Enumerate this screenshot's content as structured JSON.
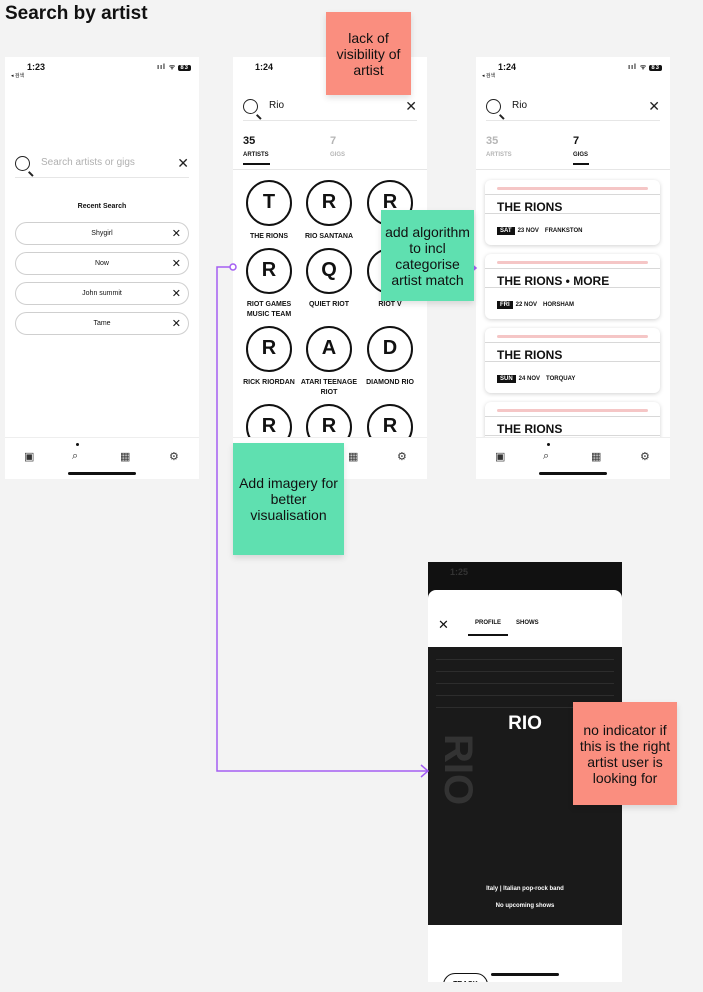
{
  "page_title": "Search by artist",
  "screens": {
    "s1": {
      "time": "1:23",
      "back": "◂ 검색",
      "signal": "ııl ᯤ",
      "battery": "83",
      "search_placeholder": "Search artists or gigs",
      "recent_title": "Recent Search",
      "recent": [
        "Shygirl",
        "Now",
        "John summit",
        "Tame"
      ]
    },
    "s2": {
      "time": "1:24",
      "query": "Rio",
      "artists_count": "35",
      "artists_label": "ARTISTS",
      "gigs_count": "7",
      "gigs_label": "GIGS",
      "artists": [
        {
          "letter": "T",
          "name": "THE RIONS"
        },
        {
          "letter": "R",
          "name": "RIO SANTANA"
        },
        {
          "letter": "R",
          "name": "R"
        },
        {
          "letter": "R",
          "name": "RIOT GAMES MUSIC TEAM"
        },
        {
          "letter": "Q",
          "name": "QUIET RIOT"
        },
        {
          "letter": "R",
          "name": "RIOT V"
        },
        {
          "letter": "R",
          "name": "RICK RIORDAN"
        },
        {
          "letter": "A",
          "name": "ATARI TEENAGE RIOT"
        },
        {
          "letter": "D",
          "name": "DIAMOND RIO"
        },
        {
          "letter": "R",
          "name": ""
        },
        {
          "letter": "R",
          "name": ""
        },
        {
          "letter": "R",
          "name": ""
        }
      ]
    },
    "s3": {
      "time": "1:24",
      "back": "◂ 검색",
      "signal": "ııl ᯤ",
      "battery": "83",
      "query": "Rio",
      "artists_count": "35",
      "artists_label": "ARTISTS",
      "gigs_count": "7",
      "gigs_label": "GIGS",
      "gigs": [
        {
          "name": "THE RIONS",
          "day": "SAT",
          "date": "23 NOV",
          "venue": "FRANKSTON"
        },
        {
          "name": "THE RIONS • MORE",
          "day": "FRI",
          "date": "22 NOV",
          "venue": "HORSHAM"
        },
        {
          "name": "THE RIONS",
          "day": "SUN",
          "date": "24 NOV",
          "venue": "TORQUAY"
        },
        {
          "name": "THE RIONS",
          "day": "",
          "date": "",
          "venue": ""
        }
      ]
    },
    "s4": {
      "time": "1:25",
      "tab_profile": "PROFILE",
      "tab_shows": "SHOWS",
      "artist": "RIO",
      "ghost": "RIO",
      "description": "Italy | Italian pop-rock band",
      "upcoming": "No upcoming shows",
      "track_label": "TRACK"
    }
  },
  "notes": {
    "lack_visibility": "lack of visibility of artist",
    "algorithm": "add algorithm to incl categorise artist match",
    "imagery": "Add imagery for better visualisation",
    "indicator": "no indicator if this is the right artist user is looking for"
  },
  "colors": {
    "note_pink": "#fa8e7f",
    "note_green": "#5fe0b0",
    "connector": "#a45ef2",
    "dark": "#111111"
  }
}
